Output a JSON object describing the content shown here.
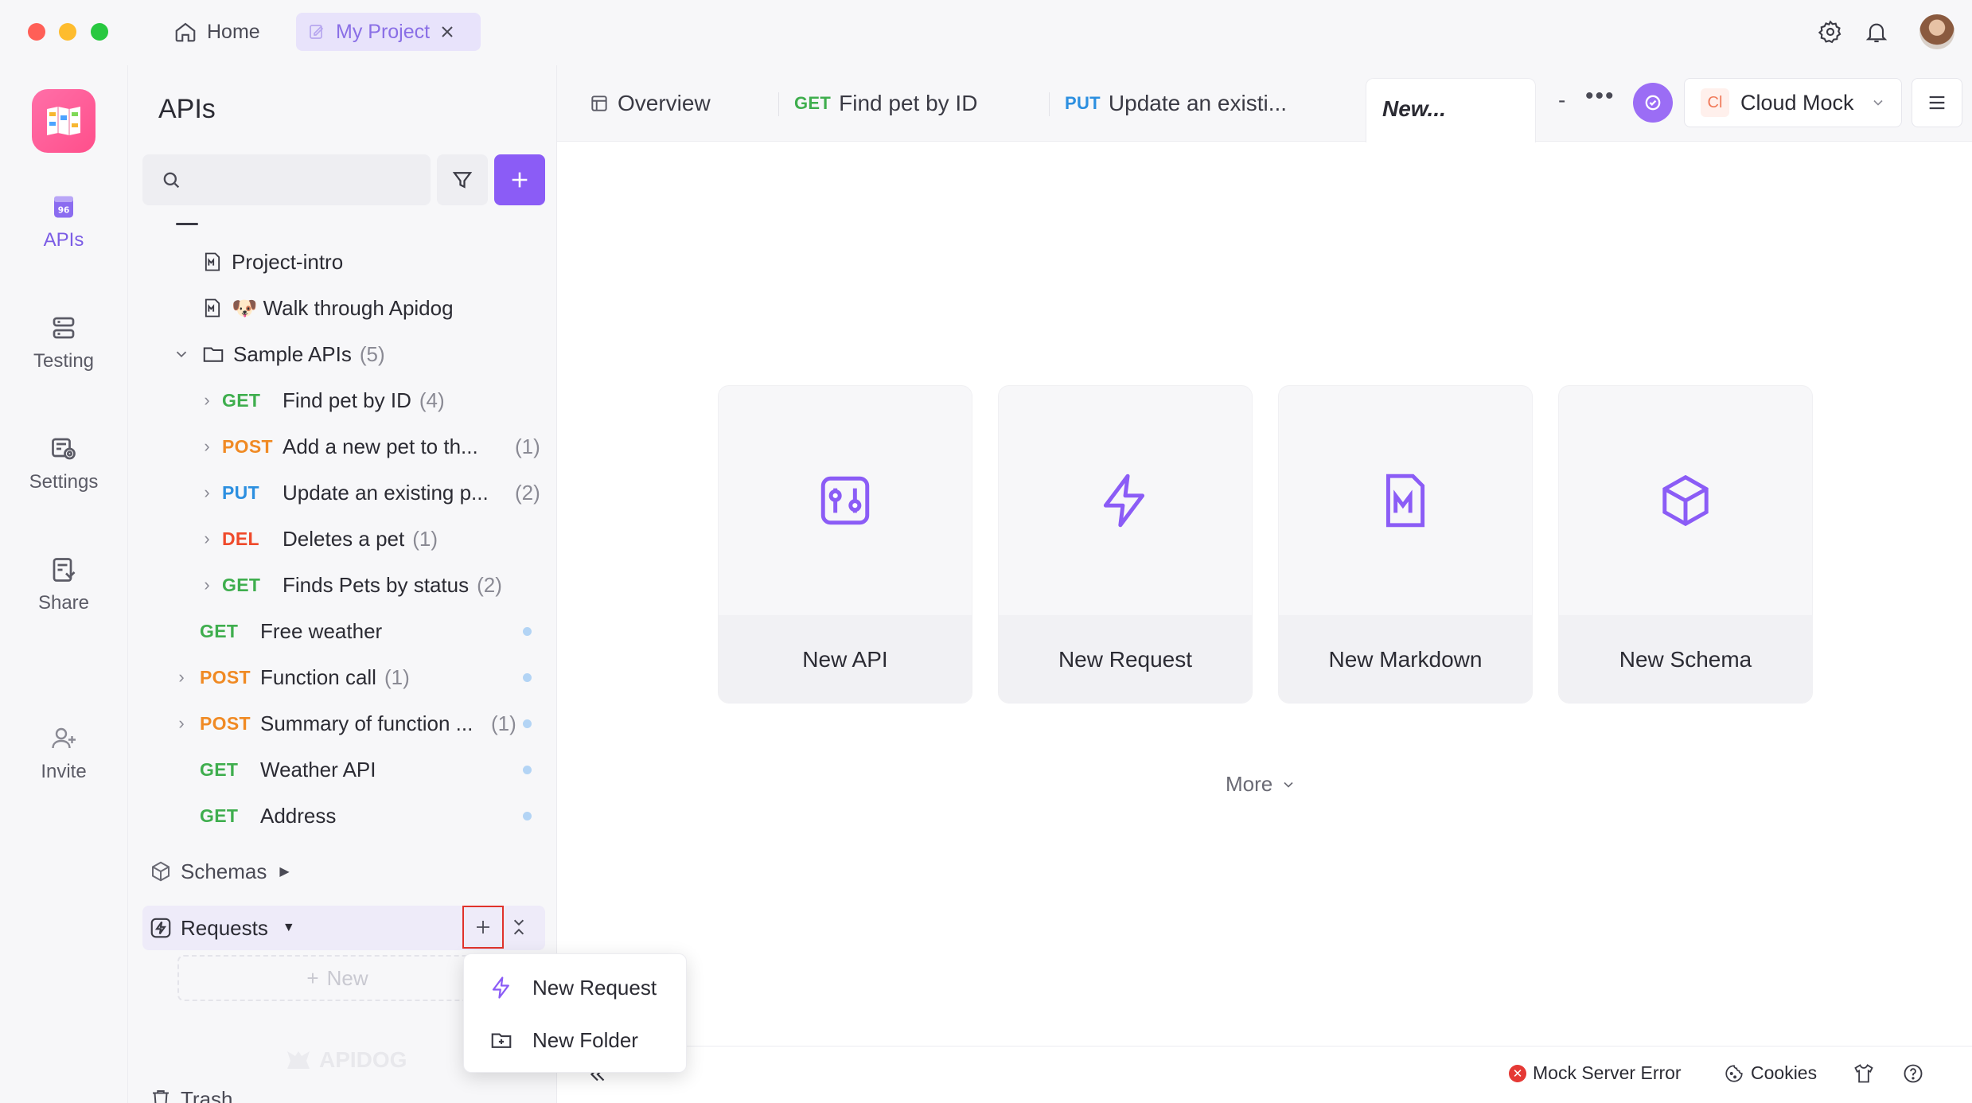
{
  "top_tabs": {
    "home": "Home",
    "project": "My Project"
  },
  "nav": [
    {
      "label": "APIs",
      "icon": "apis-icon"
    },
    {
      "label": "Testing",
      "icon": "testing-icon"
    },
    {
      "label": "Settings",
      "icon": "settings-icon"
    },
    {
      "label": "Share",
      "icon": "share-icon"
    },
    {
      "label": "Invite",
      "icon": "invite-icon"
    }
  ],
  "sidebar": {
    "title": "APIs",
    "search_placeholder": "",
    "tree": [
      {
        "type": "md",
        "label": "Project-intro"
      },
      {
        "type": "md",
        "label": "🐶 Walk through Apidog"
      },
      {
        "type": "folder",
        "label": "Sample APIs",
        "count": "(5)"
      },
      {
        "method": "GET",
        "label": "Find pet by ID",
        "count": "(4)"
      },
      {
        "method": "POST",
        "label": "Add a new pet to th...",
        "count": "(1)"
      },
      {
        "method": "PUT",
        "label": "Update an existing p...",
        "count": "(2)"
      },
      {
        "method": "DEL",
        "label": "Deletes a pet",
        "count": "(1)"
      },
      {
        "method": "GET",
        "label": "Finds Pets by status",
        "count": "(2)"
      },
      {
        "method": "GET",
        "label": "Free weather",
        "count": ""
      },
      {
        "method": "POST",
        "label": "Function call",
        "count": "(1)"
      },
      {
        "method": "POST",
        "label": "Summary of function ...",
        "count": "(1)"
      },
      {
        "method": "GET",
        "label": "Weather API",
        "count": ""
      },
      {
        "method": "GET",
        "label": "Address",
        "count": ""
      }
    ],
    "schemas": "Schemas",
    "requests": "Requests",
    "new_label": "New",
    "trash": "Trash",
    "watermark": "APIDOG"
  },
  "main_tabs": [
    {
      "method": "",
      "label": "Overview"
    },
    {
      "method": "GET",
      "label": "Find pet by ID"
    },
    {
      "method": "PUT",
      "label": "Update an existi..."
    },
    {
      "method": "",
      "label": "New..."
    }
  ],
  "tab_extras": {
    "dash": "-",
    "env_badge": "Cl",
    "env": "Cloud Mock"
  },
  "cards": [
    {
      "label": "New API",
      "icon": "api-icon"
    },
    {
      "label": "New Request",
      "icon": "lightning-icon"
    },
    {
      "label": "New Markdown",
      "icon": "markdown-icon"
    },
    {
      "label": "New Schema",
      "icon": "cube-icon"
    }
  ],
  "more": "More",
  "dropdown": [
    {
      "label": "New Request",
      "icon": "lightning-icon"
    },
    {
      "label": "New Folder",
      "icon": "folder-plus-icon"
    }
  ],
  "status": {
    "mock": "Mock Server Error",
    "cookies": "Cookies"
  },
  "colors": {
    "accent": "#8b5cf6",
    "get": "#3fae4e",
    "post": "#f08a24",
    "put": "#2c8fe0",
    "del": "#ef4a2b",
    "error": "#e53935"
  }
}
